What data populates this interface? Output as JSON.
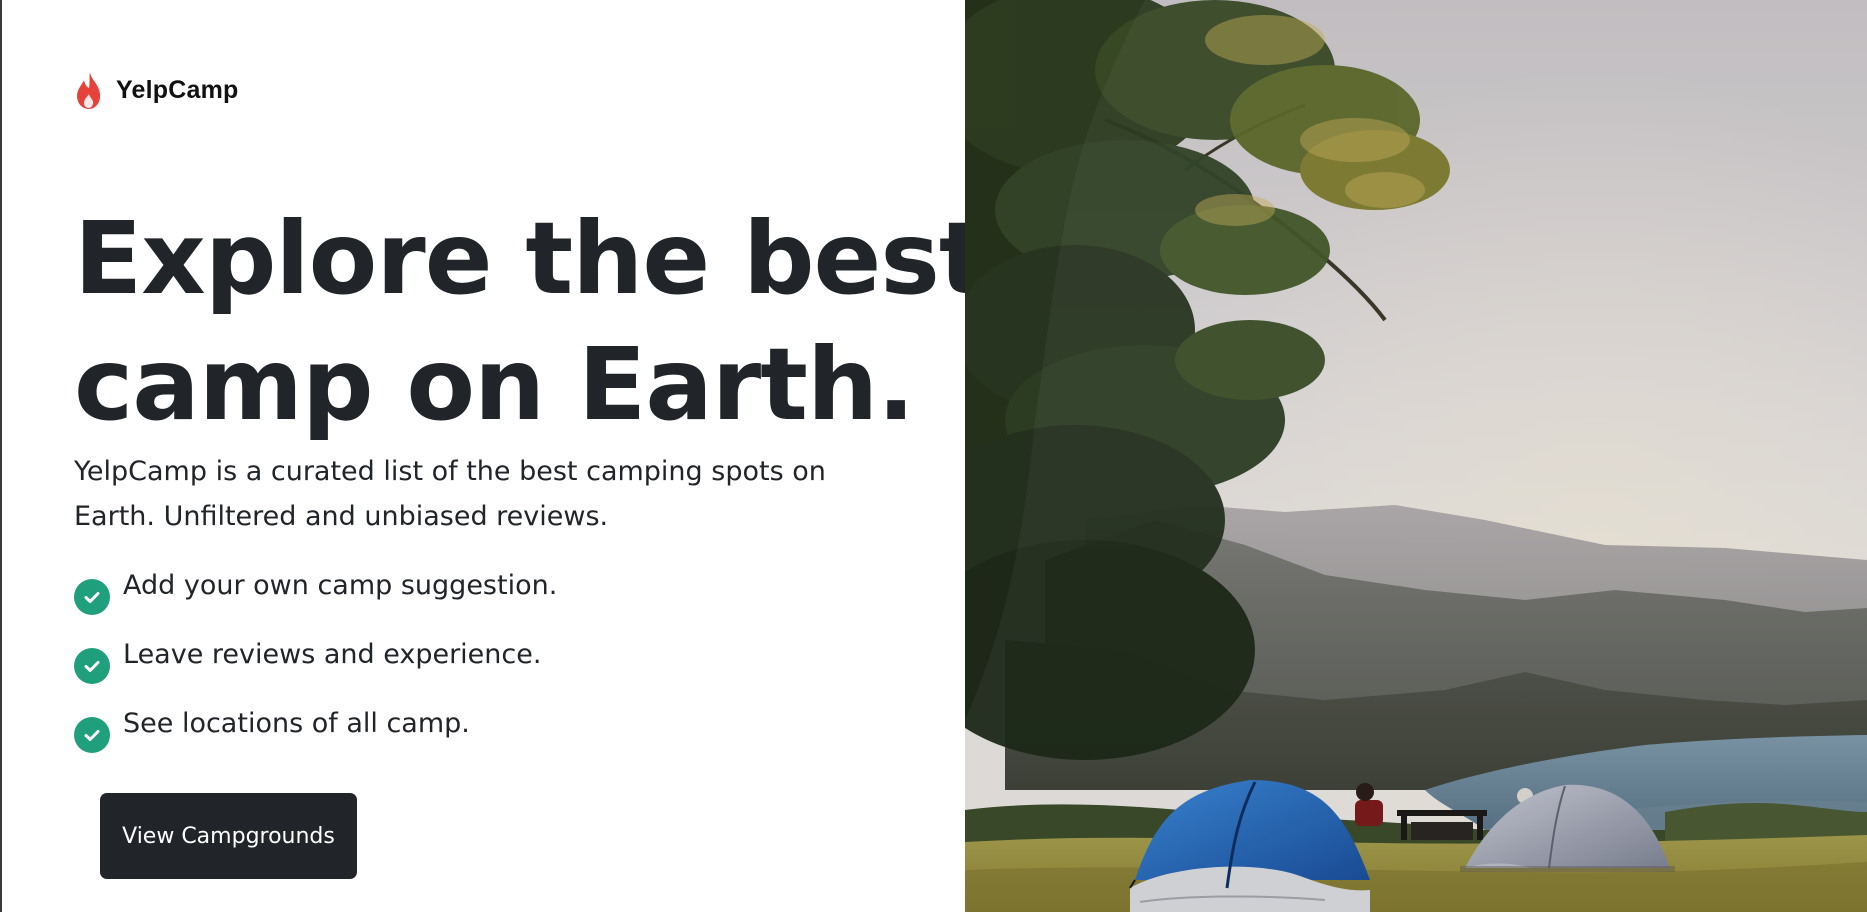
{
  "brand": {
    "name": "YelpCamp",
    "icon": "flame-icon",
    "icon_color": "#e8413a"
  },
  "hero": {
    "title_line1": "Explore the best",
    "title_line2": "camp on Earth.",
    "lead": "YelpCamp is a curated list of the best camping spots on Earth. Unfiltered and unbiased reviews."
  },
  "features": [
    {
      "icon": "check-circle-icon",
      "text": "Add your own camp suggestion."
    },
    {
      "icon": "check-circle-icon",
      "text": "Leave reviews and experience."
    },
    {
      "icon": "check-circle-icon",
      "text": "See locations of all camp."
    }
  ],
  "cta": {
    "label": "View Campgrounds"
  },
  "colors": {
    "text": "#212529",
    "check": "#1f9f7b",
    "button_bg": "#212529",
    "button_text": "#ffffff"
  },
  "hero_image": {
    "subject": "camping-landscape-photo"
  }
}
